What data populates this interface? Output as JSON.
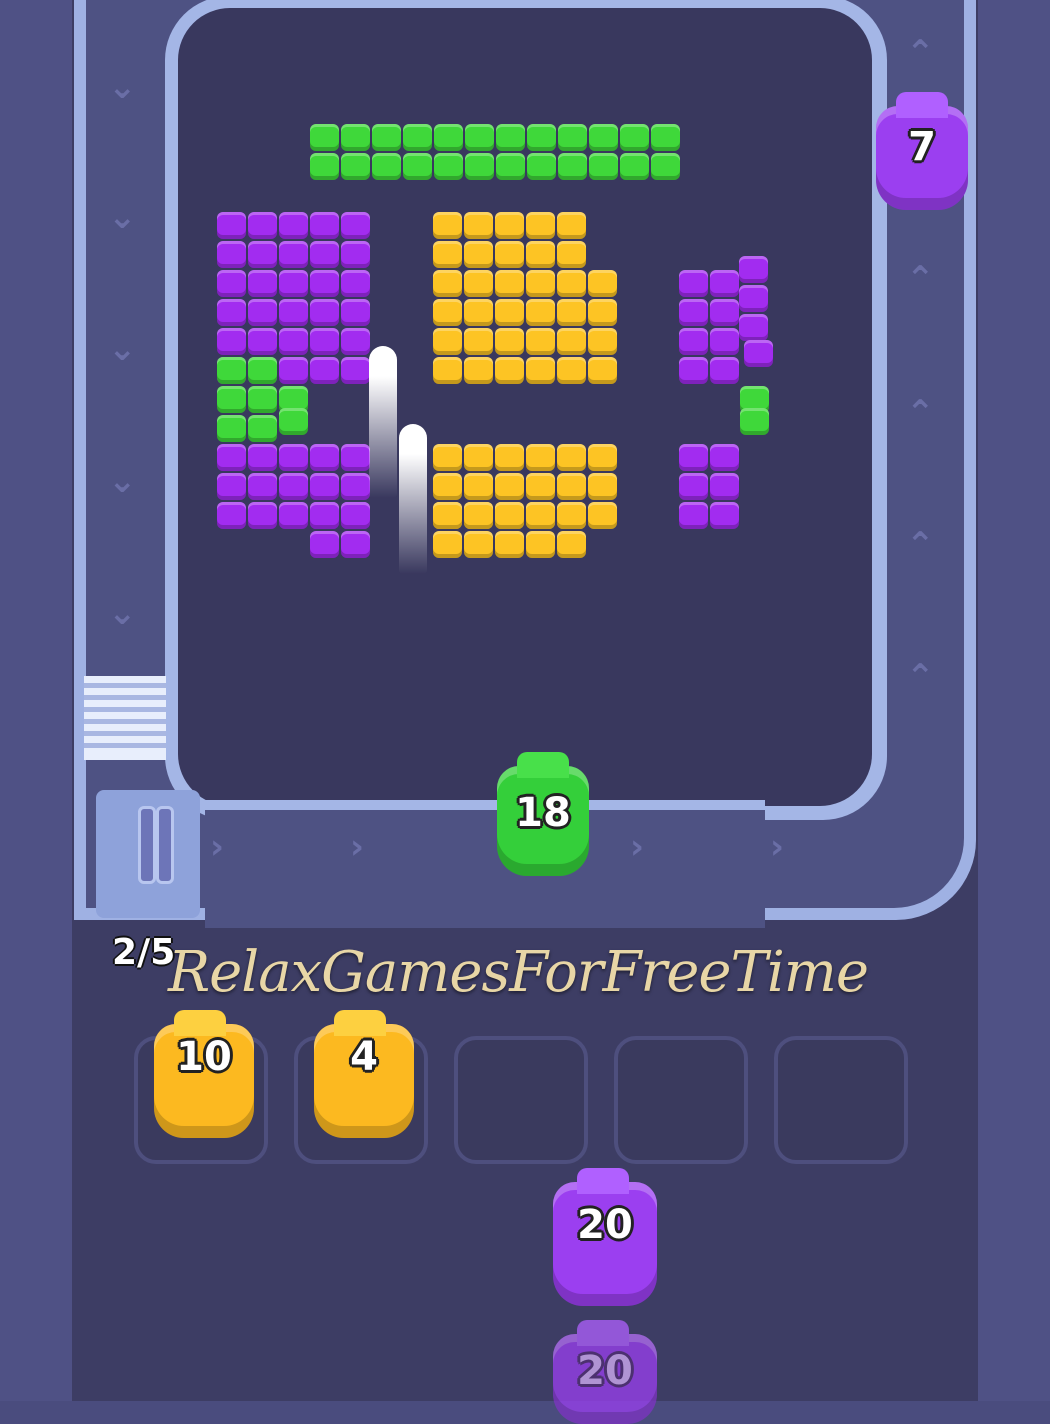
{
  "hud": {
    "slot_counter": "2/5",
    "watermark": "RelaxGamesForFreeTime"
  },
  "colors": {
    "green": "#3fd83a",
    "purple": "#a22cf0",
    "yellow": "#fdc424",
    "board": "#39385e",
    "track": "#9fb1e3"
  },
  "conveyor": {
    "shooters": [
      {
        "color": "green",
        "count": "18"
      },
      {
        "color": "purple",
        "count": "7"
      }
    ]
  },
  "holding_slots": [
    {
      "color": "yellow",
      "count": "10",
      "occupied": true
    },
    {
      "color": "yellow",
      "count": "4",
      "occupied": true
    },
    {
      "occupied": false
    },
    {
      "occupied": false
    },
    {
      "occupied": false
    }
  ],
  "queue": [
    {
      "color": "purple",
      "count": "20"
    },
    {
      "color": "purple",
      "count": "20"
    }
  ],
  "icons": {
    "track_arrow": "chevron-icon"
  }
}
